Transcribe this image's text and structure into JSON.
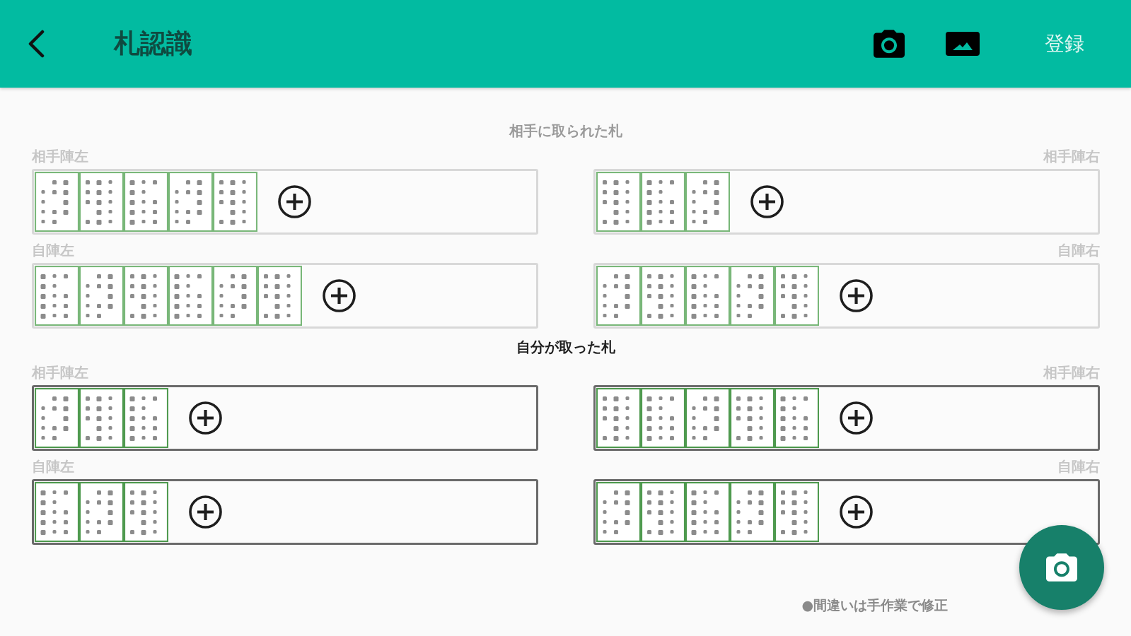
{
  "app_bar": {
    "title": "札認識",
    "action": "登録"
  },
  "sections": [
    {
      "heading": "相手に取られた札",
      "active": false,
      "zones": [
        {
          "label": "相手陣左",
          "cards": [
            {
              "kind": "card"
            },
            {
              "kind": "card"
            },
            {
              "kind": "card"
            },
            {
              "kind": "card"
            },
            {
              "kind": "card"
            }
          ]
        },
        {
          "label": "相手陣右",
          "cards": [
            {
              "kind": "card"
            },
            {
              "kind": "card"
            },
            {
              "kind": "card"
            }
          ]
        },
        {
          "label": "自陣左",
          "cards": [
            {
              "kind": "card"
            },
            {
              "kind": "card"
            },
            {
              "kind": "card"
            },
            {
              "kind": "card"
            },
            {
              "kind": "card"
            },
            {
              "kind": "card"
            }
          ]
        },
        {
          "label": "自陣右",
          "cards": [
            {
              "kind": "card"
            },
            {
              "kind": "card"
            },
            {
              "kind": "card"
            },
            {
              "kind": "card"
            },
            {
              "kind": "card"
            }
          ]
        }
      ]
    },
    {
      "heading": "自分が取った札",
      "active": true,
      "zones": [
        {
          "label": "相手陣左",
          "cards": [
            {
              "kind": "card"
            },
            {
              "kind": "card"
            },
            {
              "kind": "card"
            }
          ]
        },
        {
          "label": "相手陣右",
          "cards": [
            {
              "kind": "card"
            },
            {
              "kind": "card"
            },
            {
              "kind": "card"
            },
            {
              "kind": "card"
            },
            {
              "kind": "card"
            }
          ]
        },
        {
          "label": "自陣左",
          "cards": [
            {
              "kind": "card"
            },
            {
              "kind": "card"
            },
            {
              "kind": "card"
            }
          ]
        },
        {
          "label": "自陣右",
          "cards": [
            {
              "kind": "card"
            },
            {
              "kind": "card"
            },
            {
              "kind": "card"
            },
            {
              "kind": "card"
            },
            {
              "kind": "card"
            }
          ]
        }
      ]
    }
  ],
  "note": "●間違いは手作業で修正"
}
